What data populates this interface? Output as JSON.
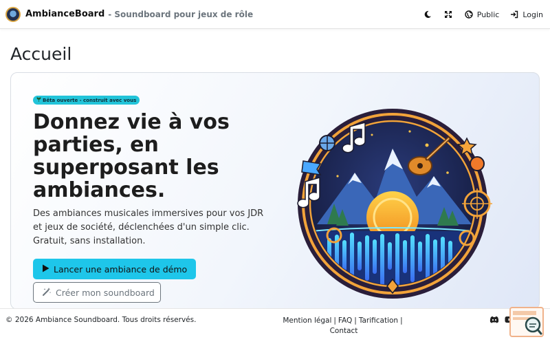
{
  "navbar": {
    "brand_name": "AmbianceBoard",
    "brand_tagline": "- Soundboard pour jeux de rôle",
    "icons": [
      "moon-icon",
      "fullscreen-icon",
      "globe-icon",
      "login-icon"
    ],
    "public_label": "Public",
    "login_label": "Login"
  },
  "page": {
    "title": "Accueil"
  },
  "hero": {
    "badge": "Bêta ouverte - construit avec vous",
    "badge_icon": "seedling-icon",
    "title": "Donnez vie à vos parties, en superposant les ambiances.",
    "subtitle": "Des ambiances musicales immersives pour vos JDR et jeux de société, déclenchées d'un simple clic. Gratuit, sans installation.",
    "demo_button": "Lancer une ambiance de démo",
    "create_button": "Créer mon soundboard",
    "art": "soundboard-emblem-illustration"
  },
  "footer": {
    "copyright": "© 2026 Ambiance Soundboard. Tous droits réservés.",
    "links": {
      "legal": "Mention légal",
      "faq": "FAQ",
      "pricing": "Tarification",
      "contact": "Contact"
    },
    "social_icons": [
      "discord-icon",
      "youtube-icon"
    ]
  },
  "colors": {
    "accent": "#1ec6ea",
    "badge": "#22c4d9",
    "text": "#212529",
    "muted": "#6c757d"
  }
}
